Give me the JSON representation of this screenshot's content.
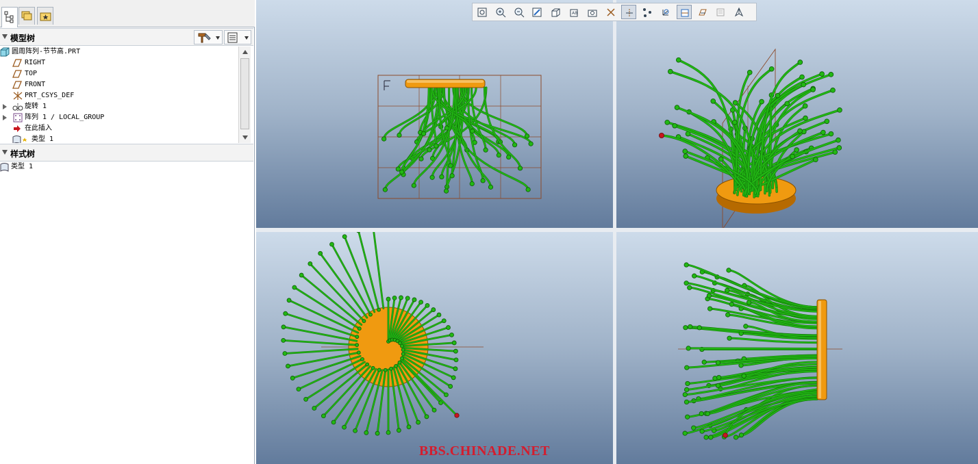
{
  "model_tree": {
    "title": "模型树",
    "items": [
      {
        "label": "圆周阵列-节节高.PRT",
        "icon": "part-icon"
      },
      {
        "label": "RIGHT",
        "icon": "datum-plane-icon"
      },
      {
        "label": "TOP",
        "icon": "datum-plane-icon"
      },
      {
        "label": "FRONT",
        "icon": "datum-plane-icon"
      },
      {
        "label": "PRT_CSYS_DEF",
        "icon": "csys-icon"
      },
      {
        "label": "旋转 1",
        "icon": "revolve-icon"
      },
      {
        "label": "阵列 1 / LOCAL_GROUP",
        "icon": "pattern-icon"
      },
      {
        "label": "在此插入",
        "icon": "insert-here-arrow-icon"
      },
      {
        "label": "类型 1",
        "icon": "style-icon"
      }
    ]
  },
  "style_tree": {
    "title": "样式树",
    "items": [
      {
        "label": "类型 1",
        "icon": "style-icon"
      }
    ]
  },
  "toolbar": {
    "buttons": [
      {
        "name": "zoom-fit-icon",
        "active": false
      },
      {
        "name": "zoom-in-icon",
        "active": false
      },
      {
        "name": "zoom-out-icon",
        "active": false
      },
      {
        "name": "repaint-icon",
        "active": false
      },
      {
        "name": "shading-icon",
        "active": false
      },
      {
        "name": "saved-views-icon",
        "active": false
      },
      {
        "name": "view-manager-icon",
        "active": false
      },
      {
        "name": "datum-display-icon",
        "active": false
      },
      {
        "name": "axis-display-icon",
        "active": true
      },
      {
        "name": "point-display-icon",
        "active": false
      },
      {
        "name": "csys-display-icon",
        "active": false
      },
      {
        "name": "plane-display-icon",
        "active": true
      },
      {
        "name": "spin-center-icon",
        "active": false
      },
      {
        "name": "annotation-display-icon",
        "active": false
      },
      {
        "name": "orient-mode-icon",
        "active": false
      }
    ]
  },
  "colors": {
    "stems": "#22b814",
    "disc": "#f09a10",
    "red_end": "#c8161e",
    "datum": "#8c4a2a",
    "viewport_top": "#cddbea",
    "viewport_bottom": "#627b9c"
  },
  "watermark": "BBS.CHINADE.NET"
}
